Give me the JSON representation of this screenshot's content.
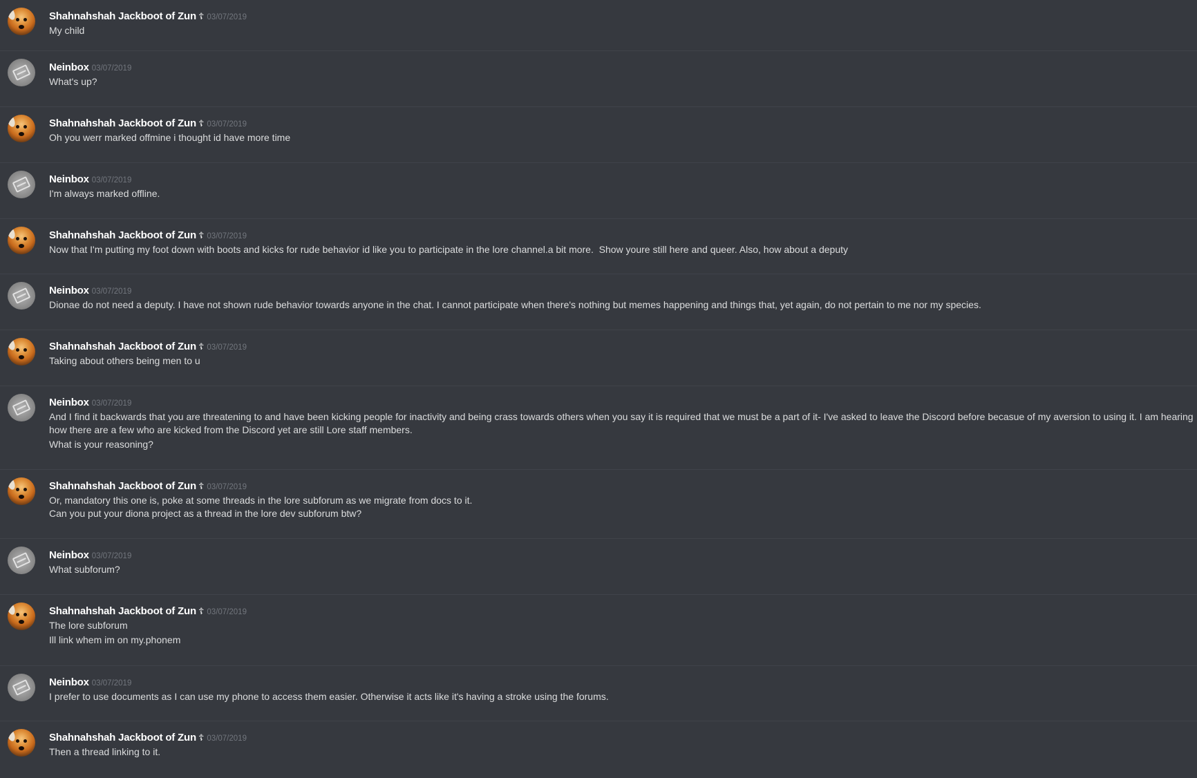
{
  "messages": [
    {
      "author": "Shahnahshah Jackboot of Zun",
      "badge": "☦",
      "avatar_icon": "dog-avatar",
      "timestamp": "03/07/2019",
      "lines": [
        "My child"
      ]
    },
    {
      "author": "Neinbox",
      "badge": "",
      "avatar_icon": "box-avatar",
      "timestamp": "03/07/2019",
      "lines": [
        "What's up?"
      ]
    },
    {
      "author": "Shahnahshah Jackboot of Zun",
      "badge": "☦",
      "avatar_icon": "dog-avatar",
      "timestamp": "03/07/2019",
      "lines": [
        "Oh you werr marked offmine i thought id have more time"
      ]
    },
    {
      "author": "Neinbox",
      "badge": "",
      "avatar_icon": "box-avatar",
      "timestamp": "03/07/2019",
      "lines": [
        "I'm always marked offline."
      ]
    },
    {
      "author": "Shahnahshah Jackboot of Zun",
      "badge": "☦",
      "avatar_icon": "dog-avatar",
      "timestamp": "03/07/2019",
      "lines": [
        "Now that I'm putting my foot down with boots and kicks for rude behavior id like you to participate in the lore channel.a bit more.  Show youre still here and queer. Also, how about a deputy"
      ]
    },
    {
      "author": "Neinbox",
      "badge": "",
      "avatar_icon": "box-avatar",
      "timestamp": "03/07/2019",
      "lines": [
        "Dionae do not need a deputy. I have not shown rude behavior towards anyone in the chat. I cannot participate when there's nothing but memes happening and things that, yet again, do not pertain to me nor my species."
      ]
    },
    {
      "author": "Shahnahshah Jackboot of Zun",
      "badge": "☦",
      "avatar_icon": "dog-avatar",
      "timestamp": "03/07/2019",
      "lines": [
        "Taking about others being men to u"
      ]
    },
    {
      "author": "Neinbox",
      "badge": "",
      "avatar_icon": "box-avatar",
      "timestamp": "03/07/2019",
      "lines": [
        "And I find it backwards that you are threatening to and have been kicking people for inactivity and being crass towards others when you say it is required that we must be a part of it- I've asked to leave the Discord before becasue of my aversion to using it. I am hearing how there are a few who are kicked from the Discord yet are still Lore staff members.",
        "What is your reasoning?"
      ]
    },
    {
      "author": "Shahnahshah Jackboot of Zun",
      "badge": "☦",
      "avatar_icon": "dog-avatar",
      "timestamp": "03/07/2019",
      "lines": [
        "Or, mandatory this one is, poke at some threads in the lore subforum as we migrate from docs to it.\nCan you put your diona project as a thread in the lore dev subforum btw?"
      ]
    },
    {
      "author": "Neinbox",
      "badge": "",
      "avatar_icon": "box-avatar",
      "timestamp": "03/07/2019",
      "lines": [
        "What subforum?"
      ]
    },
    {
      "author": "Shahnahshah Jackboot of Zun",
      "badge": "☦",
      "avatar_icon": "dog-avatar",
      "timestamp": "03/07/2019",
      "lines": [
        "The lore subforum",
        "Ill link whem im on my.phonem"
      ]
    },
    {
      "author": "Neinbox",
      "badge": "",
      "avatar_icon": "box-avatar",
      "timestamp": "03/07/2019",
      "lines": [
        "I prefer to use documents as I can use my phone to access them easier. Otherwise it acts like it's having a stroke using the forums."
      ]
    },
    {
      "author": "Shahnahshah Jackboot of Zun",
      "badge": "☦",
      "avatar_icon": "dog-avatar",
      "timestamp": "03/07/2019",
      "lines": [
        "Then a thread linking to it."
      ]
    }
  ]
}
